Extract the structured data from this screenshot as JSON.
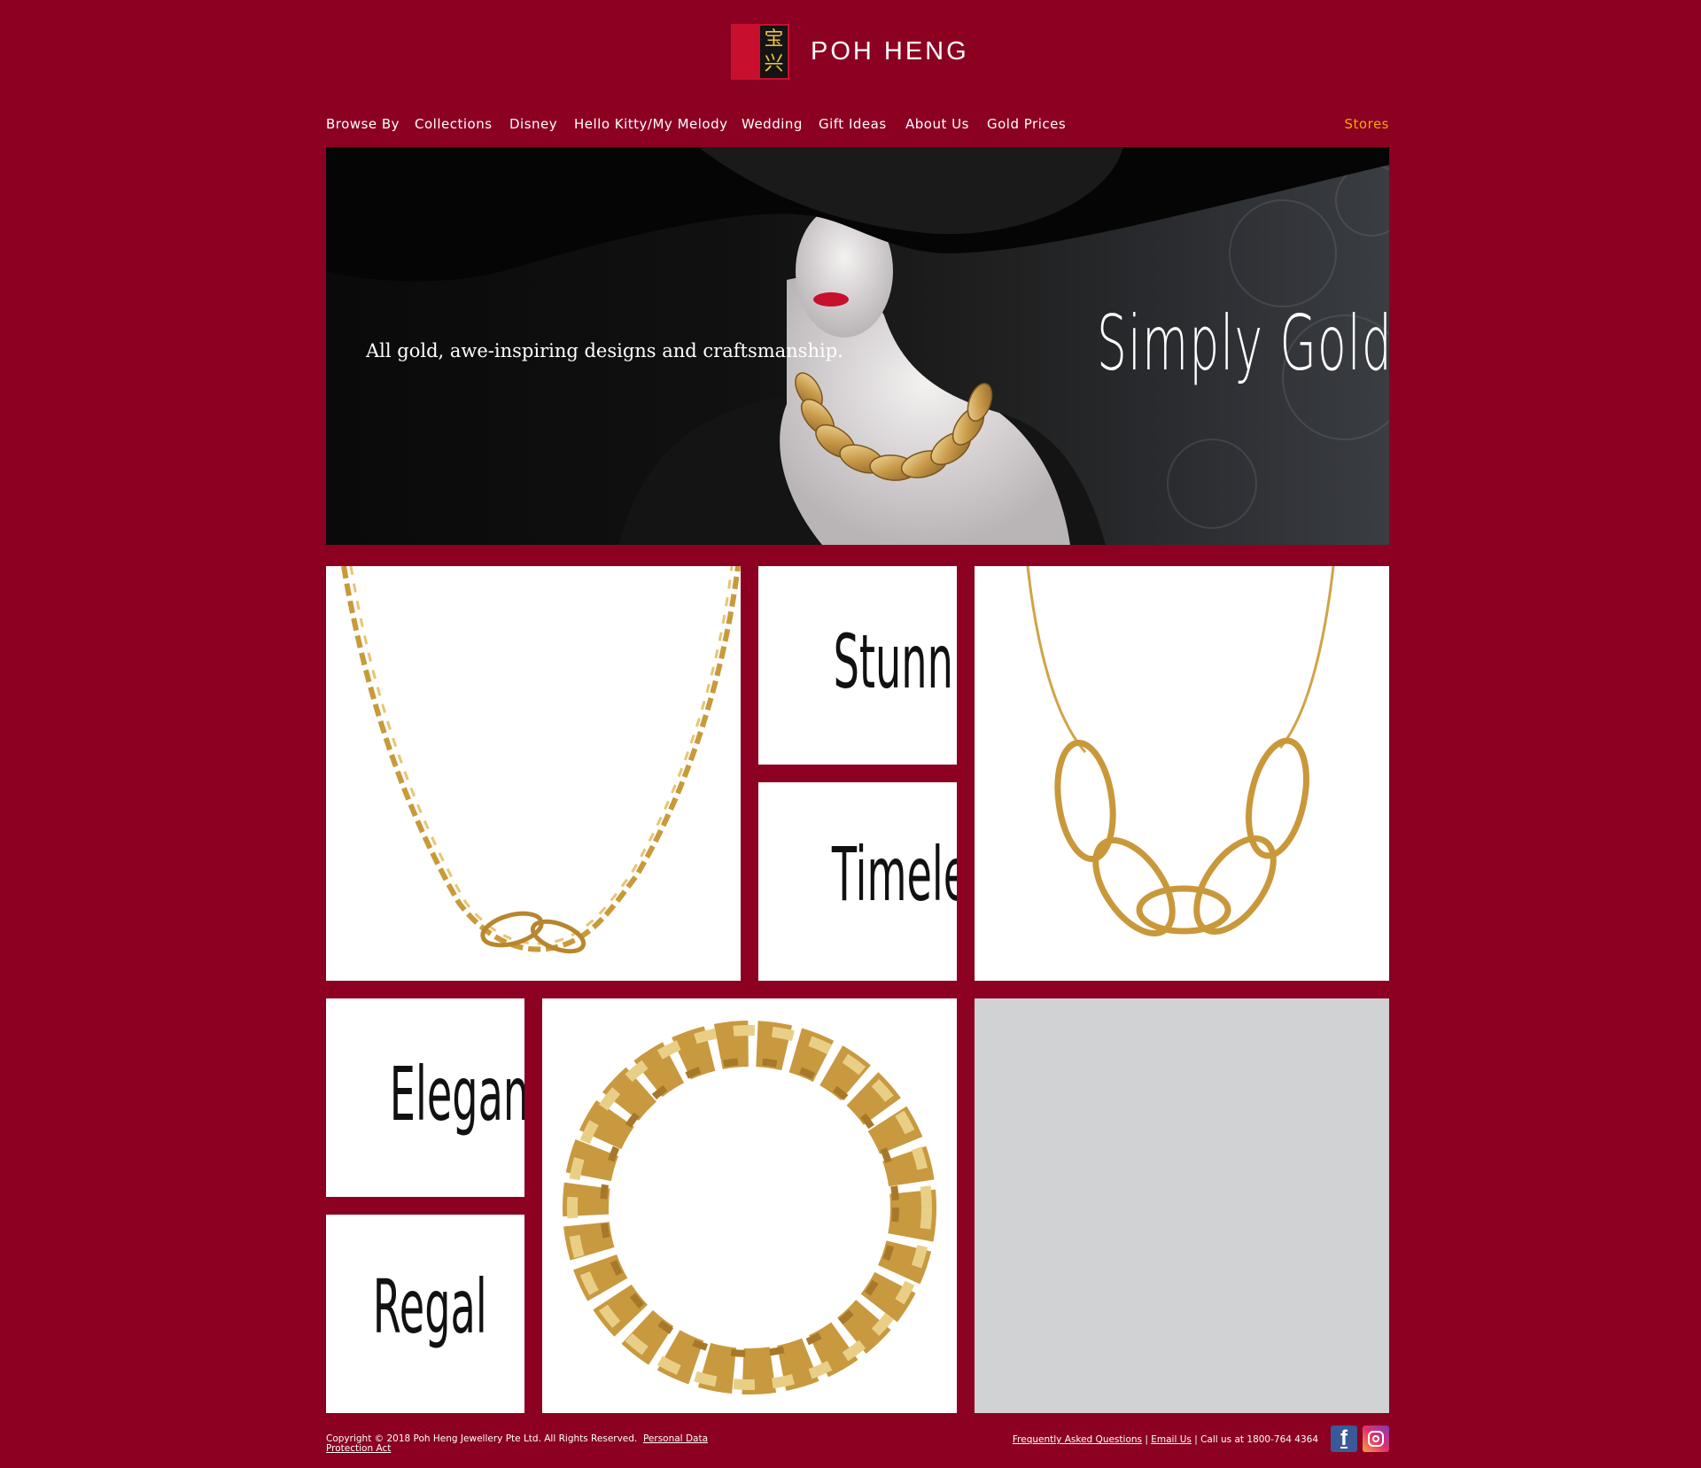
{
  "brand": {
    "name": "POH HENG",
    "seal_chars": [
      "宝",
      "兴"
    ]
  },
  "nav": {
    "items": [
      "Browse By",
      "Collections",
      "Disney",
      "Hello Kitty/My Melody",
      "Wedding",
      "Gift Ideas",
      "About Us",
      "Gold Prices"
    ],
    "stores": "Stores"
  },
  "hero": {
    "tagline": "All gold, awe-inspiring designs and craftsmanship.",
    "title": "Simply Gold"
  },
  "tiles": {
    "words": [
      "Stunning",
      "Timeless",
      "Elegant",
      "Regal"
    ]
  },
  "footer": {
    "copyright": "Copyright © 2018 Poh Heng Jewellery Pte Ltd. All Rights Reserved.",
    "pdpa_link": "Personal Data Protection Act",
    "faq_link": "Frequently Asked Questions",
    "separator": "|",
    "email_link": "Email Us",
    "call_text": "Call us at 1800-764 4364"
  },
  "colors": {
    "background": "#8c0022",
    "stores_accent": "#f2a900",
    "gold": "#d4a84a",
    "logo_red": "#c8102e"
  },
  "icons": [
    "facebook-icon",
    "instagram-icon"
  ]
}
